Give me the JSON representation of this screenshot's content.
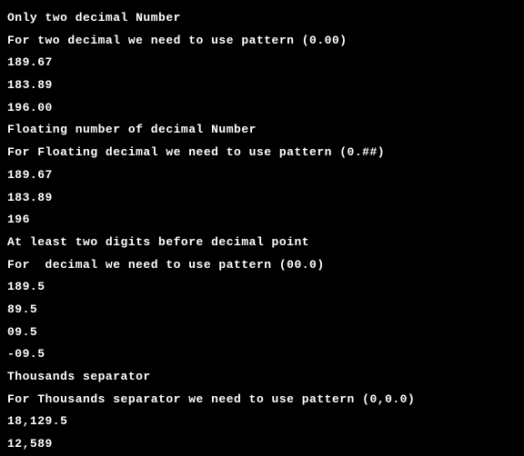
{
  "lines": [
    "Only two decimal Number",
    "For two decimal we need to use pattern (0.00)",
    "189.67",
    "183.89",
    "196.00",
    "Floating number of decimal Number",
    "For Floating decimal we need to use pattern (0.##)",
    "189.67",
    "183.89",
    "196",
    "At least two digits before decimal point",
    "For  decimal we need to use pattern (00.0)",
    "189.5",
    "89.5",
    "09.5",
    "-09.5",
    "Thousands separator",
    "For Thousands separator we need to use pattern (0,0.0)",
    "18,129.5",
    "12,589"
  ]
}
